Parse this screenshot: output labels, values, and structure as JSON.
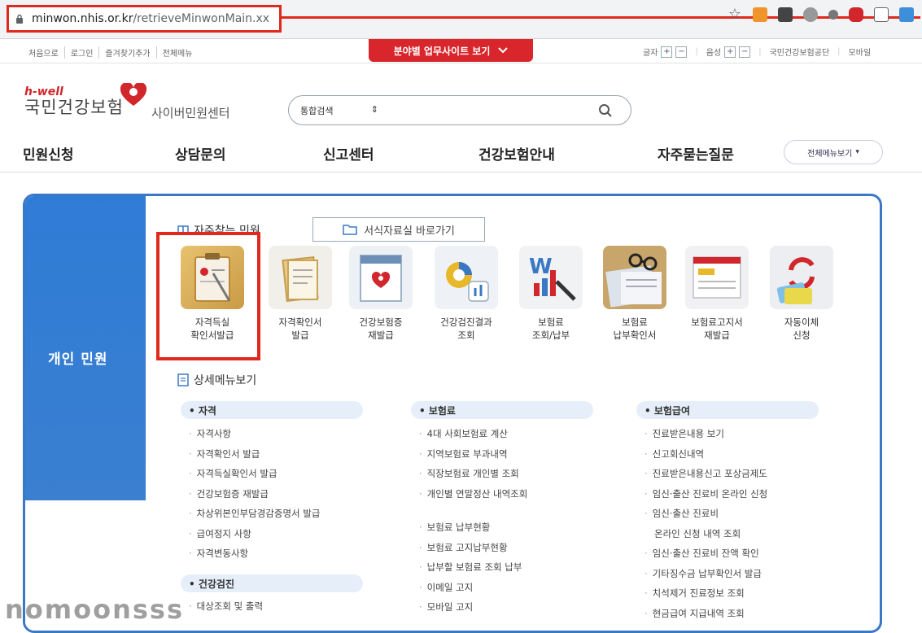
{
  "browser": {
    "url_domain": "minwon.nhis.or.kr",
    "url_path": "/retrieveMinwonMain.xx",
    "star_icon": "star-icon",
    "ext1": "ext-icon",
    "ext2": "ext-icon",
    "ext3": "ext-icon",
    "ext4": "ext-icon",
    "ext5": "ext-icon",
    "ext6": "ext-icon",
    "ext7": "ext-icon"
  },
  "topbar": {
    "links": [
      "처음으로",
      "로그인",
      "즐겨찾기추가",
      "전체메뉴"
    ],
    "site_button": "분야별 업무사이트 보기",
    "font_label": "글자",
    "sound_label": "음성",
    "plus": "+",
    "minus": "−",
    "right_links": [
      "국민건강보험공단",
      "모바일"
    ]
  },
  "header": {
    "brand_small": "h-well",
    "brand_name": "국민건강보험",
    "brand_sub": "사이버민원센터",
    "search_select": "통합검색",
    "search_arrow": "⇕"
  },
  "gnb": {
    "items": [
      "민원신청",
      "상담문의",
      "신고센터",
      "건강보험안내",
      "자주묻는질문"
    ],
    "all_menu": "전체메뉴보기"
  },
  "panel": {
    "side_label": "개인 민원",
    "freq_title": "자주찾는 민원",
    "form_button": "서식자료실 바로가기",
    "services": [
      {
        "l1": "자격득실",
        "l2": "확인서발급"
      },
      {
        "l1": "자격확인서",
        "l2": "발급"
      },
      {
        "l1": "건강보험증",
        "l2": "재발급"
      },
      {
        "l1": "건강검진결과",
        "l2": "조회"
      },
      {
        "l1": "보험료",
        "l2": "조회/납부"
      },
      {
        "l1": "보험료",
        "l2": "납부확인서"
      },
      {
        "l1": "보험료고지서",
        "l2": "재발급"
      },
      {
        "l1": "자동이체",
        "l2": "신청"
      }
    ],
    "detail_title": "상세메뉴보기",
    "col1_title": "• 자격",
    "col1": [
      "자격사항",
      "자격확인서 발급",
      "자격득실확인서 발급",
      "건강보험증 재발급",
      "차상위본인부담경감증명서 발급",
      "급여정지 사항",
      "자격변동사항"
    ],
    "col1b_title": "• 건강검진",
    "col1b": [
      "대상조회 및 출력"
    ],
    "col2_title": "• 보험료",
    "col2": [
      "4대 사회보험료 계산",
      "지역보험료 부과내역",
      "직장보험료 개인별 조회",
      "개인별 연말정산 내역조회"
    ],
    "col2b": [
      "보험료 납부현황",
      "보험료 고지납부현황",
      "납부할 보험료 조회 납부",
      "이메일 고지",
      "모바일 고지"
    ],
    "col3_title": "• 보험급여",
    "col3": [
      "진료받은내용 보기",
      "신고회신내역",
      "진료받은내용신고 포상금제도",
      "임신·출산 진료비 온라인 신청"
    ],
    "col3_multi1": "임신·출산 진료비",
    "col3_multi2": "온라인 신청 내역 조회",
    "col3b": [
      "임신·출산 진료비 잔액 확인",
      "기타징수금 납부확인서 발급",
      "치석제거 진료정보 조회",
      "현금급여 지급내역 조회"
    ]
  },
  "watermark": "nomoonsss"
}
